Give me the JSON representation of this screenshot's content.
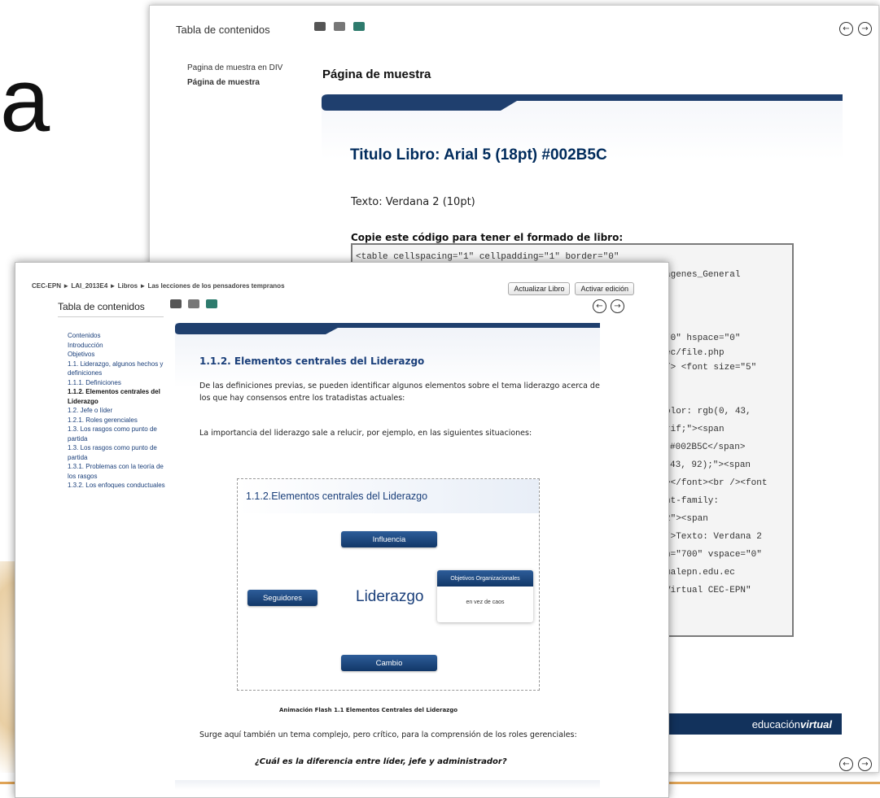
{
  "slide": {
    "letter": "a"
  },
  "back_window": {
    "toc_title": "Tabla de contenidos",
    "toc_items": [
      "Pagina de muestra en DIV",
      "Página de muestra"
    ],
    "page_title": "Página de muestra",
    "book_title": "Titulo Libro: Arial 5 (18pt) #002B5C",
    "text_sample": "Texto: Verdana 2 (10pt)",
    "copy_label": "Copie este código para tener el formado de libro:",
    "code_lines": [
      "<table cellspacing=\"1\" cellpadding=\"1\" border=\"0\"",
      "agenes_General",
      "\"0\" hspace=\"0\"",
      "ec/file.php",
      "/> <font size=\"5\"",
      ":",
      ":",
      "olor: rgb(0, 43,",
      "rif;\"><span",
      "#002B5C</span>",
      "43, 92);\"><span",
      "></font><br /><font",
      "nt-family:",
      "2\"><span",
      "\">Texto: Verdana 2",
      "h=\"700\" vspace=\"0\"",
      "ualepn.edu.ec",
      "Virtual CEC-EPN\""
    ],
    "footer_brand_light": "educación",
    "footer_brand_bold": "virtual",
    "icons": [
      "printer-icon",
      "print-all-icon",
      "book-icon",
      "arrow-left-circle-icon",
      "arrow-right-circle-icon"
    ]
  },
  "front_window": {
    "breadcrumb": "CEC-EPN ► LAI_2013E4 ► Libros ► Las lecciones de los pensadores tempranos",
    "buttons": {
      "update": "Actualizar Libro",
      "edit": "Activar edición"
    },
    "toc_title": "Tabla de contenidos",
    "toc_items": [
      {
        "label": "Contenidos",
        "active": false
      },
      {
        "label": "Introducción",
        "active": false
      },
      {
        "label": "Objetivos",
        "active": false
      },
      {
        "label": "1.1. Liderazgo, algunos hechos y definiciones",
        "active": false
      },
      {
        "label": "1.1.1. Definiciones",
        "active": false
      },
      {
        "label": "1.1.2. Elementos centrales del Liderazgo",
        "active": true
      },
      {
        "label": "1.2. Jefe o líder",
        "active": false
      },
      {
        "label": "1.2.1. Roles gerenciales",
        "active": false
      },
      {
        "label": "1.3. Los rasgos como punto de partida",
        "active": false
      },
      {
        "label": "1.3. Los rasgos como punto de partida",
        "active": false
      },
      {
        "label": "1.3.1. Problemas con la teoría de los rasgos",
        "active": false
      },
      {
        "label": "1.3.2. Los enfoques conductuales",
        "active": false
      }
    ],
    "section_title": "1.1.2. Elementos centrales del Liderazgo",
    "paragraph_1": "De las definiciones previas, se pueden identificar algunos elementos sobre el tema liderazgo acerca de los que hay consensos entre los tratadistas actuales:",
    "paragraph_2": "La importancia del liderazgo sale a relucir, por ejemplo, en las siguientes situaciones:",
    "flash": {
      "title": "1.1.2.Elementos centrales del Liderazgo",
      "influence": "Influencia",
      "followers": "Seguidores",
      "center": "Liderazgo",
      "objectives": "Objetivos Organizacionales",
      "objectives_sub": "en vez de caos",
      "change": "Cambio"
    },
    "caption": "Animación Flash 1.1 Elementos Centrales del Liderazgo",
    "paragraph_3": "Surge aquí también un tema complejo, pero crítico, para la comprensión de los roles gerenciales:",
    "question": "¿Cuál es la diferencia entre líder, jefe y administrador?"
  },
  "colors": {
    "accent": "#002B5C",
    "banner": "#1f3f6e",
    "slide_line": "#e0a456"
  }
}
